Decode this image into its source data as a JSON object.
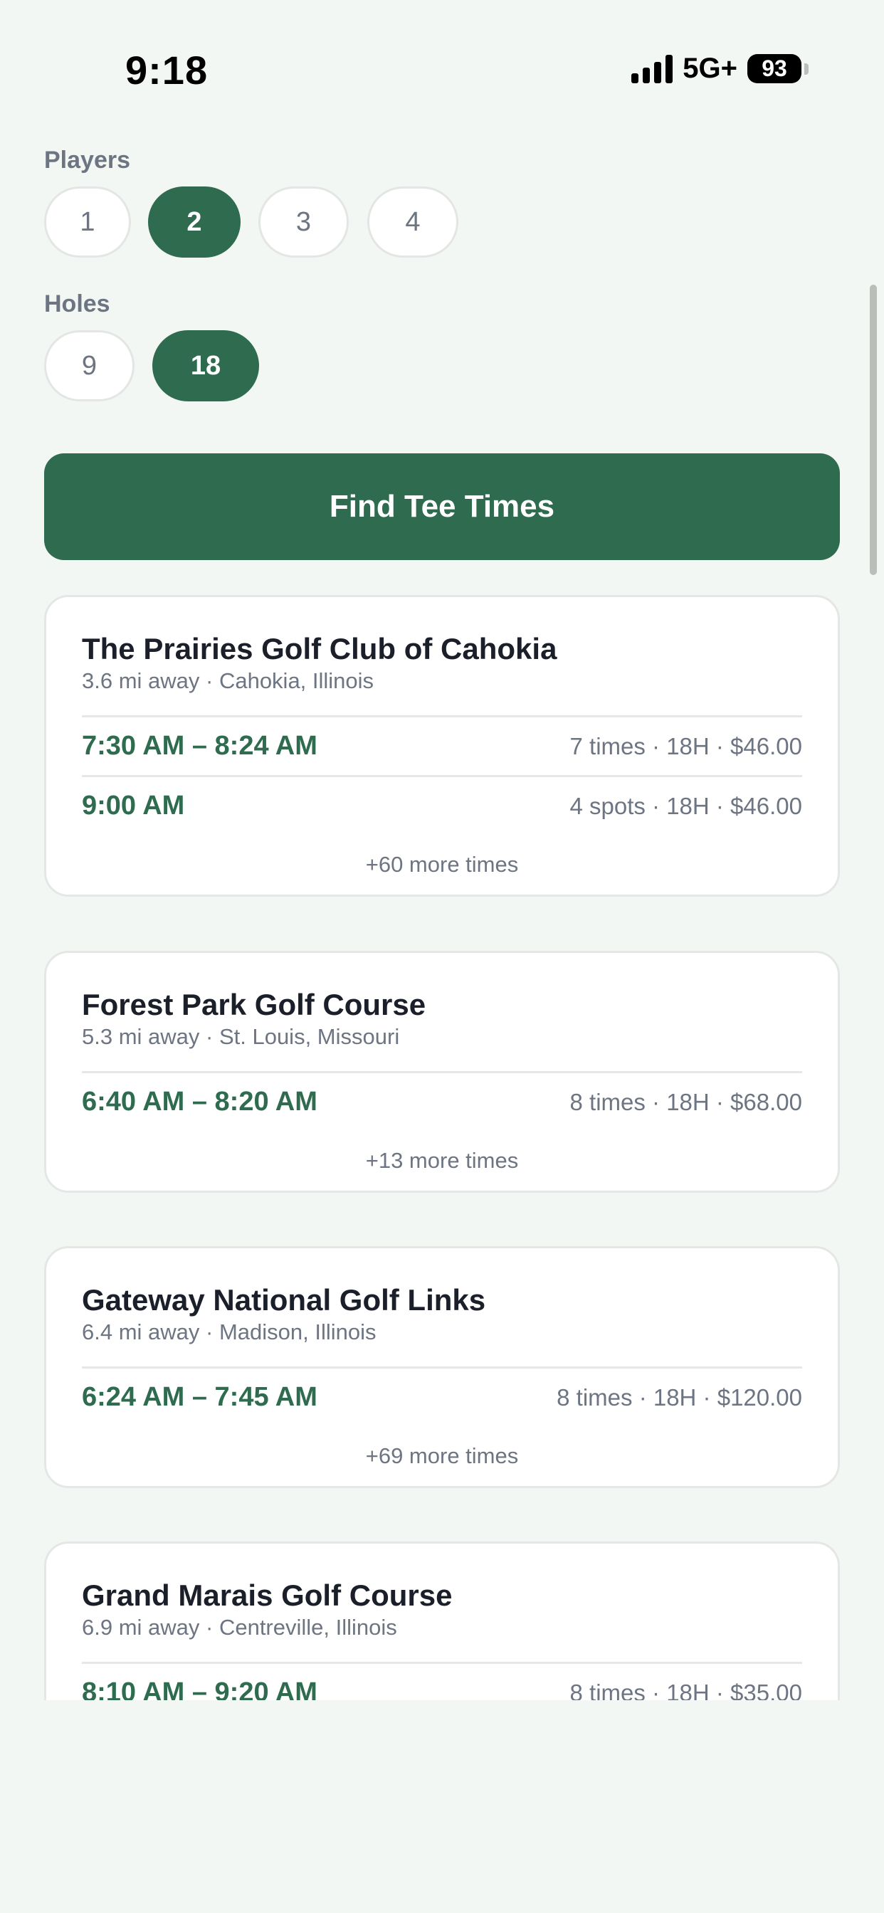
{
  "status_bar": {
    "time": "9:18",
    "network": "5G+",
    "battery": "93"
  },
  "filters": {
    "players": {
      "label": "Players",
      "options": [
        "1",
        "2",
        "3",
        "4"
      ],
      "selected": "2"
    },
    "holes": {
      "label": "Holes",
      "options": [
        "9",
        "18"
      ],
      "selected": "18"
    }
  },
  "cta": {
    "label": "Find Tee Times"
  },
  "courses": [
    {
      "name": "The Prairies Golf Club of Cahokia",
      "meta": "3.6 mi away · Cahokia, Illinois",
      "rows": [
        {
          "time": "7:30 AM – 8:24 AM",
          "info": "7 times · 18H · $46.00"
        },
        {
          "time": "9:00 AM",
          "info": "4 spots · 18H · $46.00"
        }
      ],
      "more": "+60 more times"
    },
    {
      "name": "Forest Park Golf Course",
      "meta": "5.3 mi away · St. Louis, Missouri",
      "rows": [
        {
          "time": "6:40 AM – 8:20 AM",
          "info": "8 times · 18H · $68.00"
        }
      ],
      "more": "+13 more times"
    },
    {
      "name": "Gateway National Golf Links",
      "meta": "6.4 mi away · Madison, Illinois",
      "rows": [
        {
          "time": "6:24 AM – 7:45 AM",
          "info": "8 times · 18H · $120.00"
        }
      ],
      "more": "+69 more times"
    },
    {
      "name": "Grand Marais Golf Course",
      "meta": "6.9 mi away · Centreville, Illinois",
      "rows": [
        {
          "time": "8:10 AM – 9:20 AM",
          "info": "8 times · 18H · $35.00"
        }
      ],
      "more": ""
    }
  ]
}
